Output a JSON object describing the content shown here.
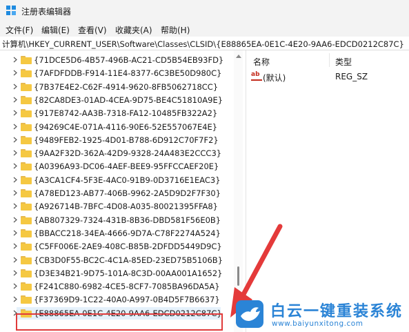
{
  "window": {
    "title": "注册表编辑器"
  },
  "menu": [
    {
      "label": "文件(F)"
    },
    {
      "label": "编辑(E)"
    },
    {
      "label": "查看(V)"
    },
    {
      "label": "收藏夹(A)"
    },
    {
      "label": "帮助(H)"
    }
  ],
  "address": {
    "path": "计算机\\HKEY_CURRENT_USER\\Software\\Classes\\CLSID\\{E88865EA-0E1C-4E20-9AA6-EDCD0212C87C}"
  },
  "tree": {
    "items": [
      {
        "label": "{71DCE5D6-4B57-496B-AC21-CD5B54EB93FD}",
        "selected": false
      },
      {
        "label": "{7AFDFDDB-F914-11E4-8377-6C3BE50D980C}",
        "selected": false
      },
      {
        "label": "{7B37E4E2-C62F-4914-9620-8FB5062718CC}",
        "selected": false
      },
      {
        "label": "{82CA8DE3-01AD-4CEA-9D75-BE4C51810A9E}",
        "selected": false
      },
      {
        "label": "{917E8742-AA3B-7318-FA12-10485FB322A2}",
        "selected": false
      },
      {
        "label": "{94269C4E-071A-4116-90E6-52E557067E4E}",
        "selected": false
      },
      {
        "label": "{9489FEB2-1925-4D01-B788-6D912C70F7F2}",
        "selected": false
      },
      {
        "label": "{9AA2F32D-362A-42D9-9328-24A483E2CCC3}",
        "selected": false
      },
      {
        "label": "{A0396A93-DC06-4AEF-BEE9-95FFCCAEF20E}",
        "selected": false
      },
      {
        "label": "{A3CA1CF4-5F3E-4AC0-91B9-0D3716E1EAC3}",
        "selected": false
      },
      {
        "label": "{A78ED123-AB77-406B-9962-2A5D9D2F7F30}",
        "selected": false
      },
      {
        "label": "{A926714B-7BFC-4D08-A035-80021395FFA8}",
        "selected": false
      },
      {
        "label": "{AB807329-7324-431B-8B36-DBD581F56E0B}",
        "selected": false
      },
      {
        "label": "{BBACC218-34EA-4666-9D7A-C78F2274A524}",
        "selected": false
      },
      {
        "label": "{C5FF006E-2AE9-408C-B85B-2DFDD5449D9C}",
        "selected": false
      },
      {
        "label": "{CB3D0F55-BC2C-4C1A-85ED-23ED75B5106B}",
        "selected": false
      },
      {
        "label": "{D3E34B21-9D75-101A-8C3D-00AA001A1652}",
        "selected": false
      },
      {
        "label": "{F241C880-6982-4CE5-8CF7-7085BA96DA5A}",
        "selected": false
      },
      {
        "label": "{F37369D9-1C22-40A0-A997-0B4D5F7B6637}",
        "selected": false
      },
      {
        "label": "{E88865EA-0E1C-4E20-9AA6-EDCD0212C87C}",
        "selected": true
      }
    ]
  },
  "values_pane": {
    "columns": {
      "name": "名称",
      "type": "类型"
    },
    "rows": [
      {
        "name": "(默认)",
        "type": "REG_SZ",
        "icon": "string-value-icon"
      }
    ]
  },
  "watermark": {
    "main": "白云一键重装系统",
    "url": "www.baiyunxitong.com"
  },
  "colors": {
    "folder": "#f5c842",
    "selection": "#e5f1fb",
    "highlight_outline": "#e03a3a",
    "watermark": "#2b84d6"
  }
}
